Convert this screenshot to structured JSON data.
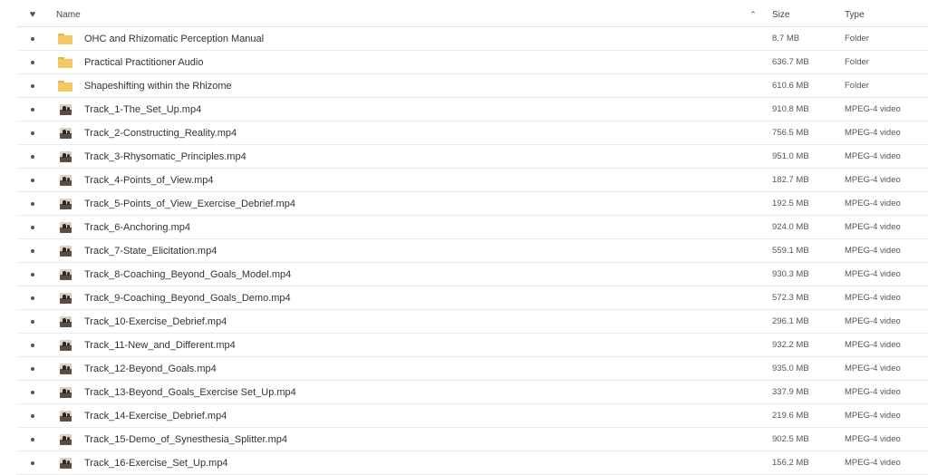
{
  "header": {
    "fav_icon": "heart-icon",
    "name_label": "Name",
    "sort_icon": "chevron-up-icon",
    "size_label": "Size",
    "type_label": "Type"
  },
  "rows": [
    {
      "icon": "folder-icon",
      "name": "OHC and Rhizomatic Perception Manual",
      "size": "8.7 MB",
      "type": "Folder"
    },
    {
      "icon": "folder-icon",
      "name": "Practical Practitioner Audio",
      "size": "636.7 MB",
      "type": "Folder"
    },
    {
      "icon": "folder-icon",
      "name": "Shapeshifting within the Rhizome",
      "size": "610.6 MB",
      "type": "Folder"
    },
    {
      "icon": "video-thumbnail-icon",
      "name": "Track_1-The_Set_Up.mp4",
      "size": "910.8 MB",
      "type": "MPEG-4 video"
    },
    {
      "icon": "video-thumbnail-icon",
      "name": "Track_2-Constructing_Reality.mp4",
      "size": "756.5 MB",
      "type": "MPEG-4 video"
    },
    {
      "icon": "video-thumbnail-icon",
      "name": "Track_3-Rhysomatic_Principles.mp4",
      "size": "951.0 MB",
      "type": "MPEG-4 video"
    },
    {
      "icon": "video-thumbnail-icon",
      "name": "Track_4-Points_of_View.mp4",
      "size": "182.7 MB",
      "type": "MPEG-4 video"
    },
    {
      "icon": "video-thumbnail-icon",
      "name": "Track_5-Points_of_View_Exercise_Debrief.mp4",
      "size": "192.5 MB",
      "type": "MPEG-4 video"
    },
    {
      "icon": "video-thumbnail-icon",
      "name": "Track_6-Anchoring.mp4",
      "size": "924.0 MB",
      "type": "MPEG-4 video"
    },
    {
      "icon": "video-thumbnail-icon",
      "name": "Track_7-State_Elicitation.mp4",
      "size": "559.1 MB",
      "type": "MPEG-4 video"
    },
    {
      "icon": "video-thumbnail-icon",
      "name": "Track_8-Coaching_Beyond_Goals_Model.mp4",
      "size": "930.3 MB",
      "type": "MPEG-4 video"
    },
    {
      "icon": "video-thumbnail-icon",
      "name": "Track_9-Coaching_Beyond_Goals_Demo.mp4",
      "size": "572.3 MB",
      "type": "MPEG-4 video"
    },
    {
      "icon": "video-thumbnail-icon",
      "name": "Track_10-Exercise_Debrief.mp4",
      "size": "296.1 MB",
      "type": "MPEG-4 video"
    },
    {
      "icon": "video-thumbnail-icon",
      "name": "Track_11-New_and_Different.mp4",
      "size": "932.2 MB",
      "type": "MPEG-4 video"
    },
    {
      "icon": "video-thumbnail-icon",
      "name": "Track_12-Beyond_Goals.mp4",
      "size": "935.0 MB",
      "type": "MPEG-4 video"
    },
    {
      "icon": "video-thumbnail-icon",
      "name": "Track_13-Beyond_Goals_Exercise Set_Up.mp4",
      "size": "337.9 MB",
      "type": "MPEG-4 video"
    },
    {
      "icon": "video-thumbnail-icon",
      "name": "Track_14-Exercise_Debrief.mp4",
      "size": "219.6 MB",
      "type": "MPEG-4 video"
    },
    {
      "icon": "video-thumbnail-icon",
      "name": "Track_15-Demo_of_Synesthesia_Splitter.mp4",
      "size": "902.5 MB",
      "type": "MPEG-4 video"
    },
    {
      "icon": "video-thumbnail-icon",
      "name": "Track_16-Exercise_Set_Up.mp4",
      "size": "156.2 MB",
      "type": "MPEG-4 video"
    }
  ]
}
